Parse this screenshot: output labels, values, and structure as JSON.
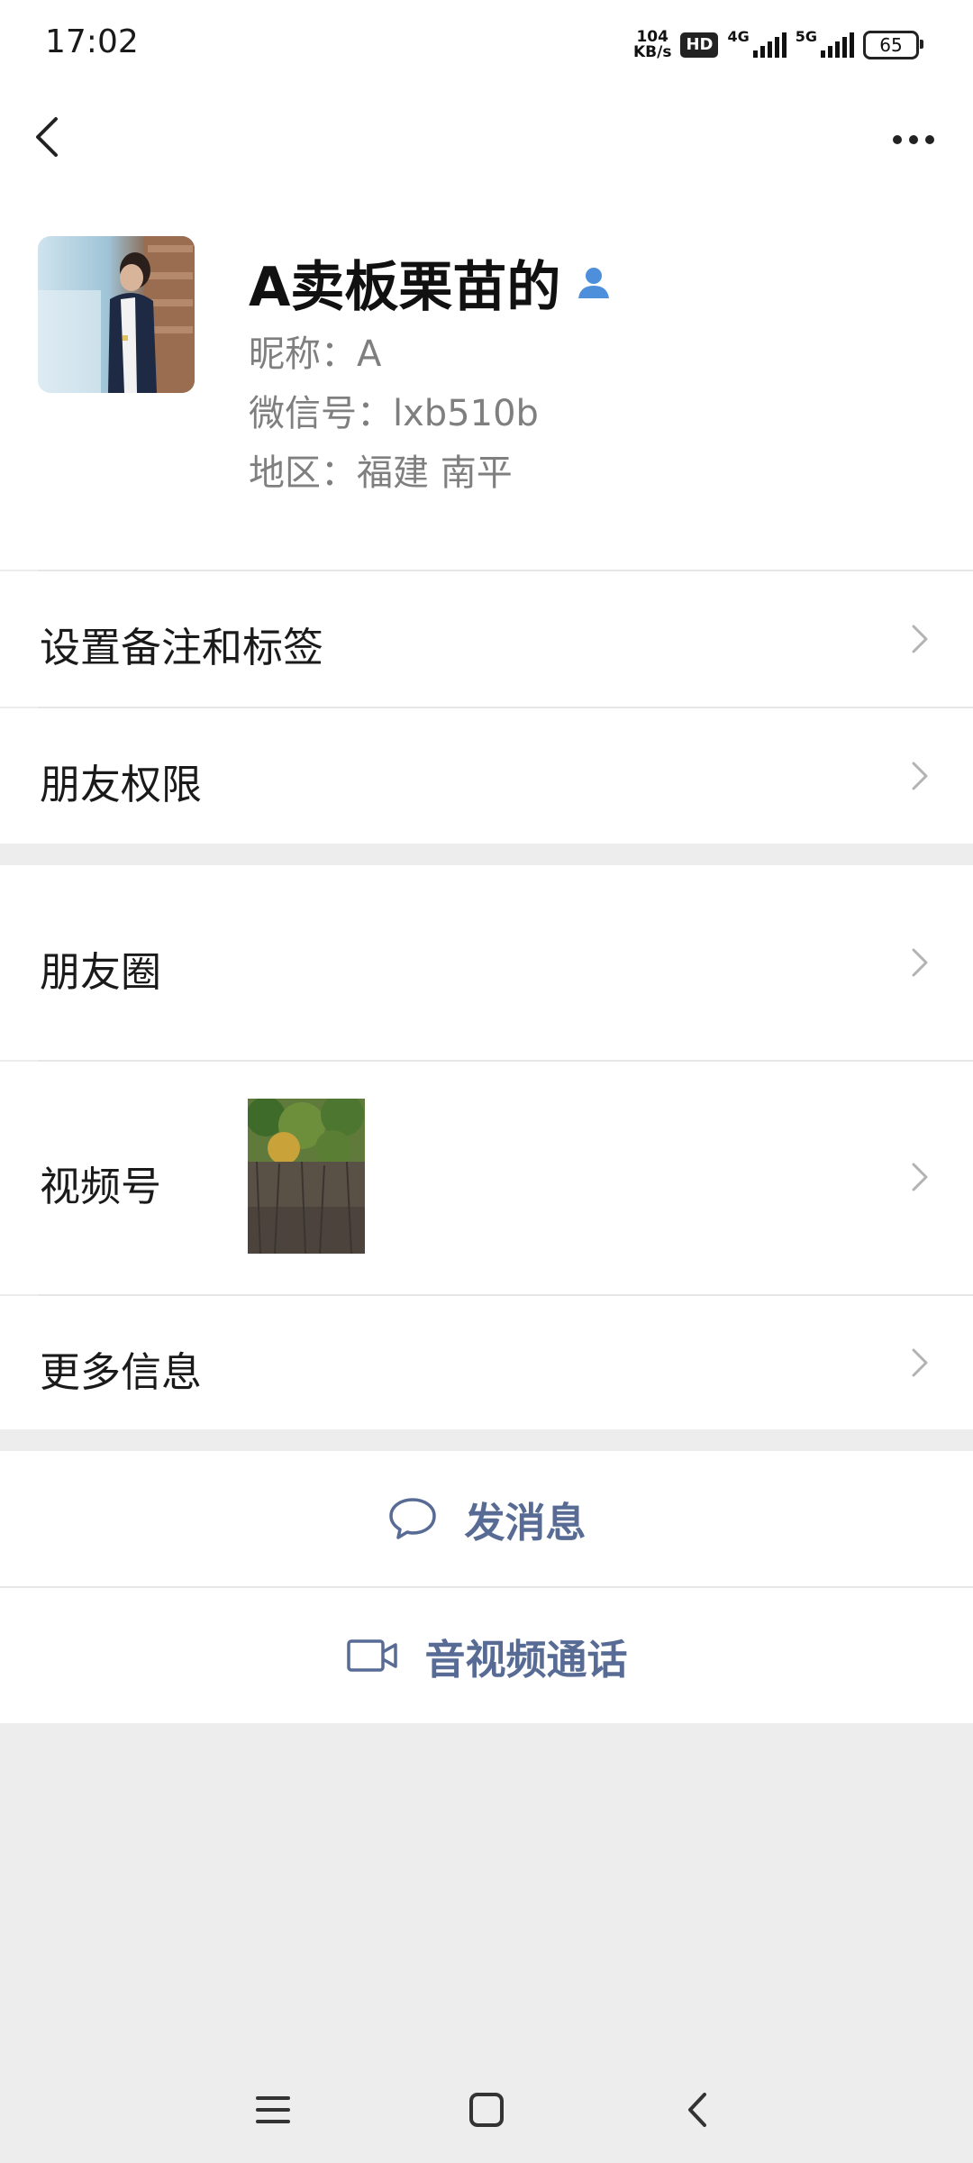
{
  "status_bar": {
    "time": "17:02",
    "speed_value": "104",
    "speed_unit": "KB/s",
    "hd_badge": "HD",
    "net1": "4G",
    "net2": "5G",
    "battery": "65"
  },
  "nav": {
    "back_icon": "chevron-left-icon",
    "more_icon": "more-dots-icon"
  },
  "profile": {
    "name": "A卖板栗苗的",
    "nickname_line": "昵称：A",
    "wechat_id_line": "微信号：lxb510b",
    "region_line": "地区：福建  南平"
  },
  "menu": {
    "remark_tags": "设置备注和标签",
    "friend_permissions": "朋友权限",
    "moments": "朋友圈",
    "channels": "视频号",
    "more_info": "更多信息"
  },
  "actions": {
    "send_message": "发消息",
    "av_call": "音视频通话"
  },
  "colors": {
    "link_blue": "#576b95",
    "background": "#ededed",
    "contact_icon_blue": "#4e8fdc"
  }
}
